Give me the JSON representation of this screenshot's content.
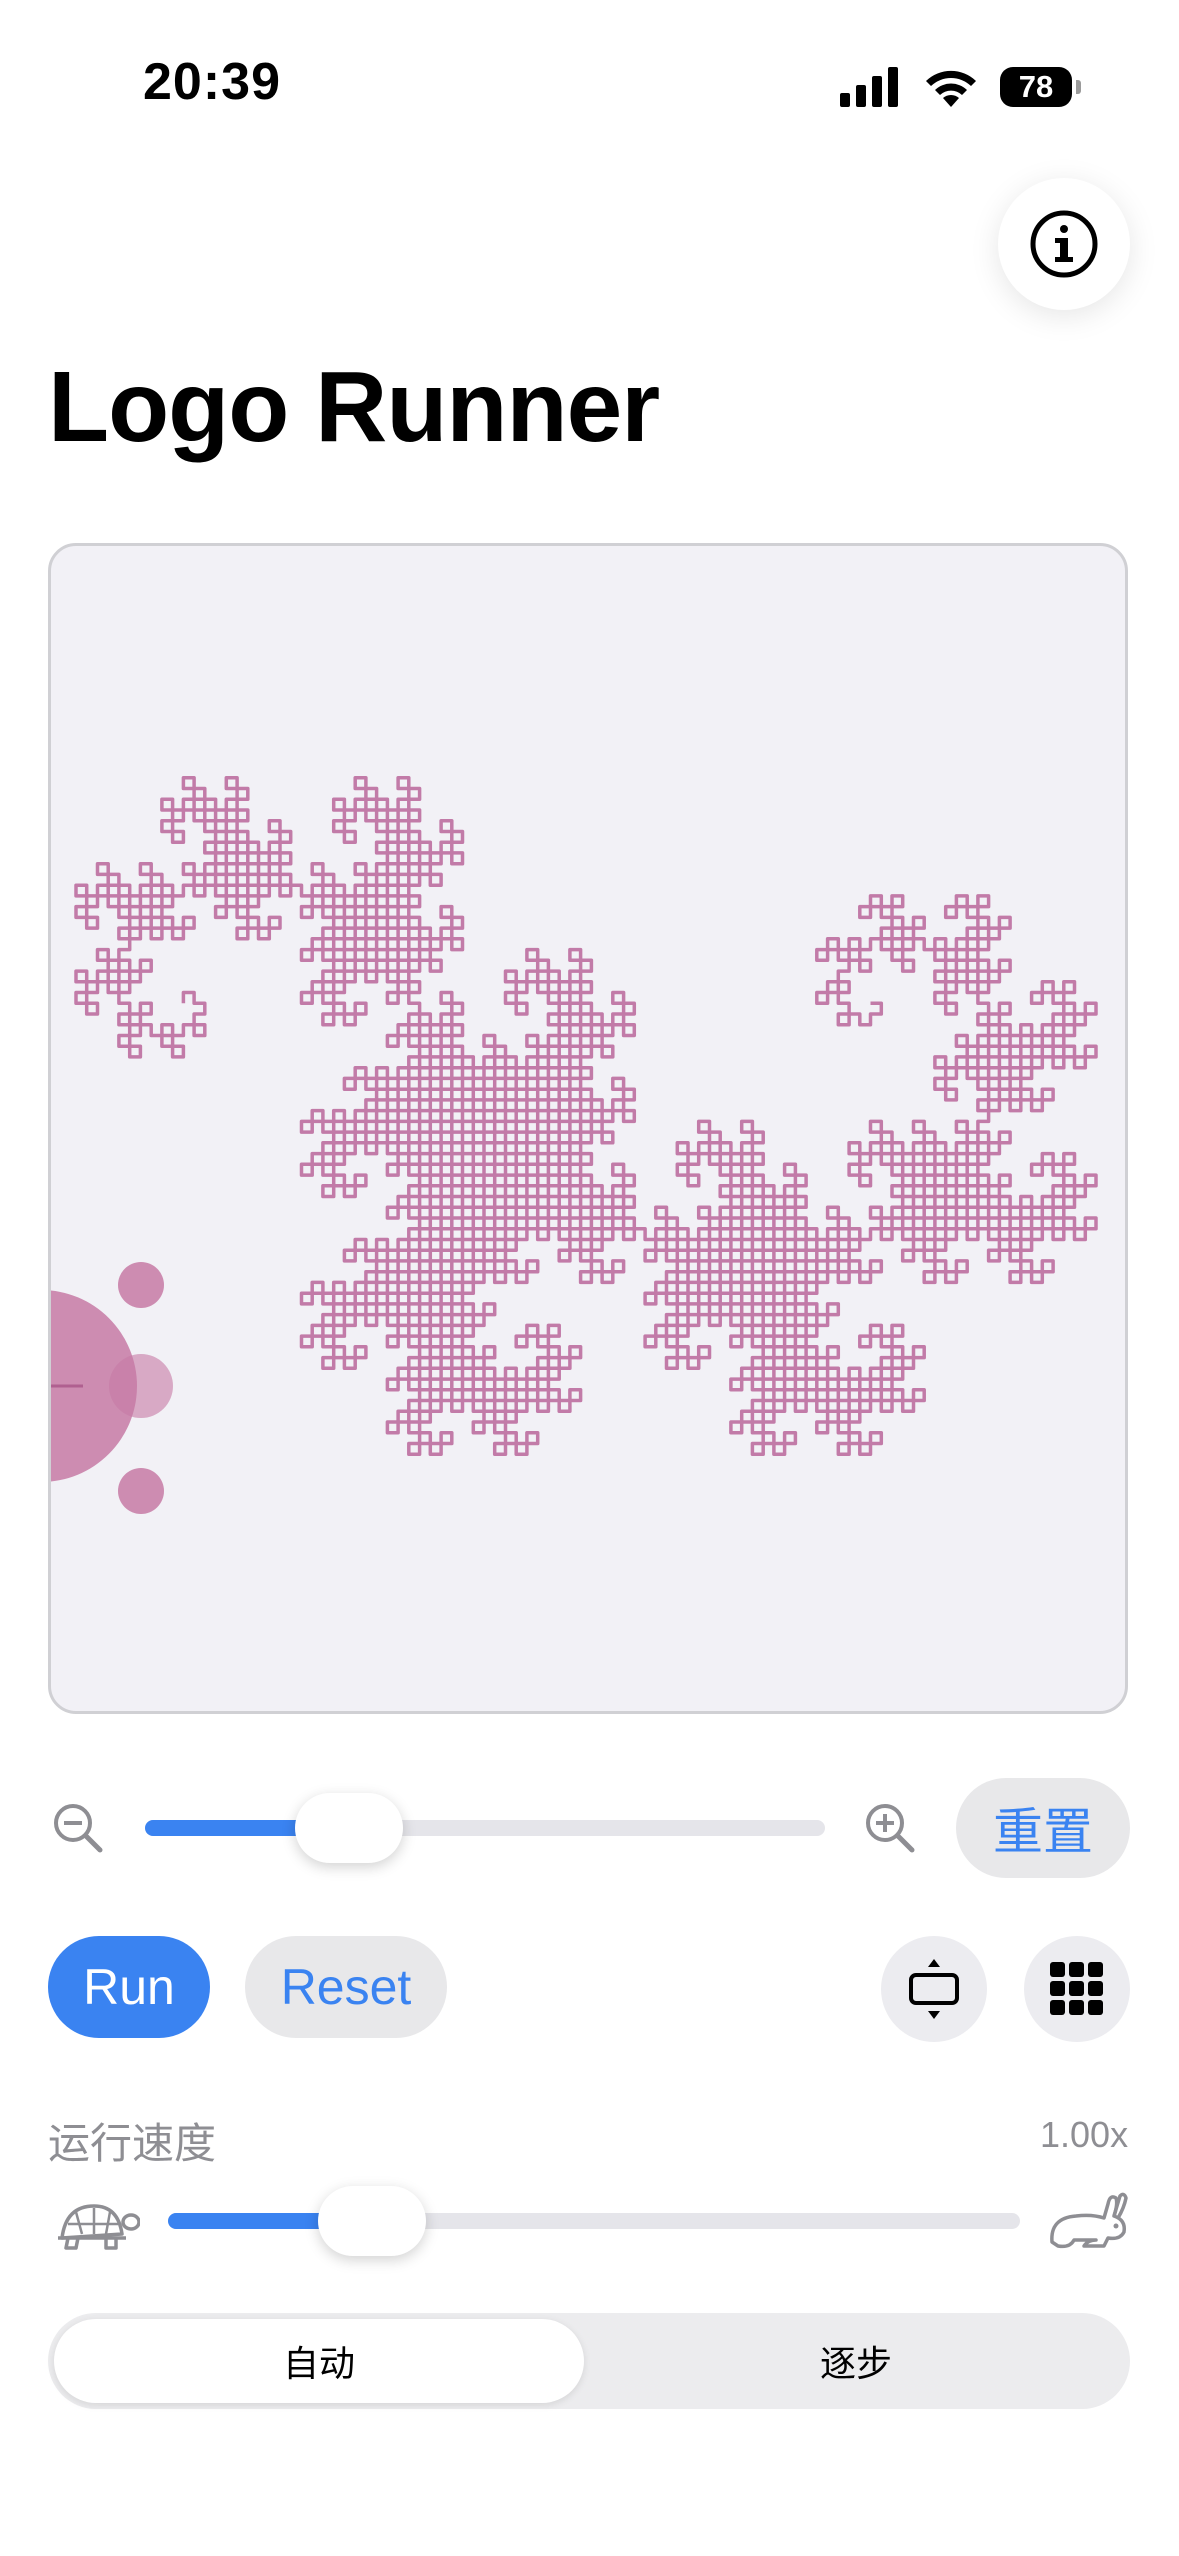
{
  "status_bar": {
    "time": "20:39",
    "battery": "78",
    "icons": [
      "cellular-signal-icon",
      "wifi-icon",
      "battery-icon"
    ]
  },
  "header": {
    "info_icon": "info-icon",
    "title": "Logo Runner"
  },
  "canvas": {
    "drawing": "dragon-curve",
    "stroke_color": "#c27ba8",
    "turtle_color": "#c77aa5",
    "background": "#f2f1f6"
  },
  "zoom": {
    "zoom_out_icon": "zoom-out-icon",
    "zoom_in_icon": "zoom-in-icon",
    "level": 0.3,
    "reset_label": "重置"
  },
  "controls": {
    "run_label": "Run",
    "reset_label": "Reset",
    "fit_icon": "fit-vertical-icon",
    "grid_icon": "grid-icon"
  },
  "speed": {
    "label": "运行速度",
    "value": "1.00x",
    "slow_icon": "turtle-icon",
    "fast_icon": "rabbit-icon",
    "level": 0.24
  },
  "mode": {
    "options": [
      "自动",
      "逐步"
    ],
    "selected": "自动"
  },
  "colors": {
    "accent": "#3a83f1",
    "track": "#e5e5ea"
  }
}
